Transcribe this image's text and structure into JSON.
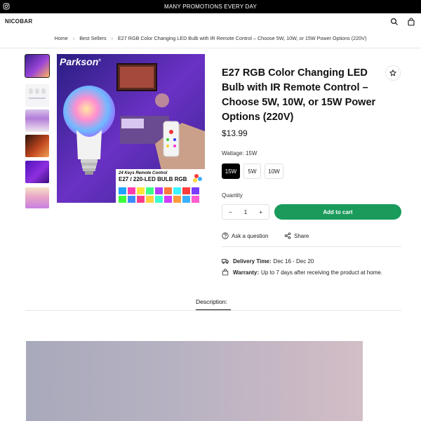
{
  "announcement": "MANY PROMOTIONS EVERY DAY",
  "header": {
    "logo": "NICOBAR"
  },
  "breadcrumb": {
    "items": [
      "Home",
      "Best Sellers",
      "E27 RGB Color Changing LED Bulb with IR Remote Control – Choose 5W, 10W, or 15W Power Options (220V)"
    ],
    "separator": "›"
  },
  "gallery": {
    "brand": "Parkson",
    "brand_mark": "®",
    "caption_line1": "24 Keys Remote Control",
    "caption_line2": "E27 / 220-LED BULB RGB",
    "thumb_count": 6
  },
  "product": {
    "title": "E27 RGB Color Changing LED Bulb with IR Remote Control – Choose 5W, 10W, or 15W Power Options (220V)",
    "price": "$13.99",
    "wattage_label": "Wattage: 15W",
    "options": [
      "15W",
      "5W",
      "10W"
    ],
    "selected_option": "15W",
    "quantity_label": "Quantity",
    "quantity": "1",
    "minus": "−",
    "plus": "+",
    "add_to_cart": "Add to cart",
    "ask": "Ask a question",
    "share": "Share",
    "delivery_label": "Delivery Time:",
    "delivery_value": "Dec 16 - Dec 20",
    "warranty_label": "Warranty:",
    "warranty_value": "Up to 7 days after receiving the product at home."
  },
  "tabs": {
    "description": "Description:"
  },
  "colors": {
    "accent": "#1a9b5b",
    "bar": "#000000"
  }
}
